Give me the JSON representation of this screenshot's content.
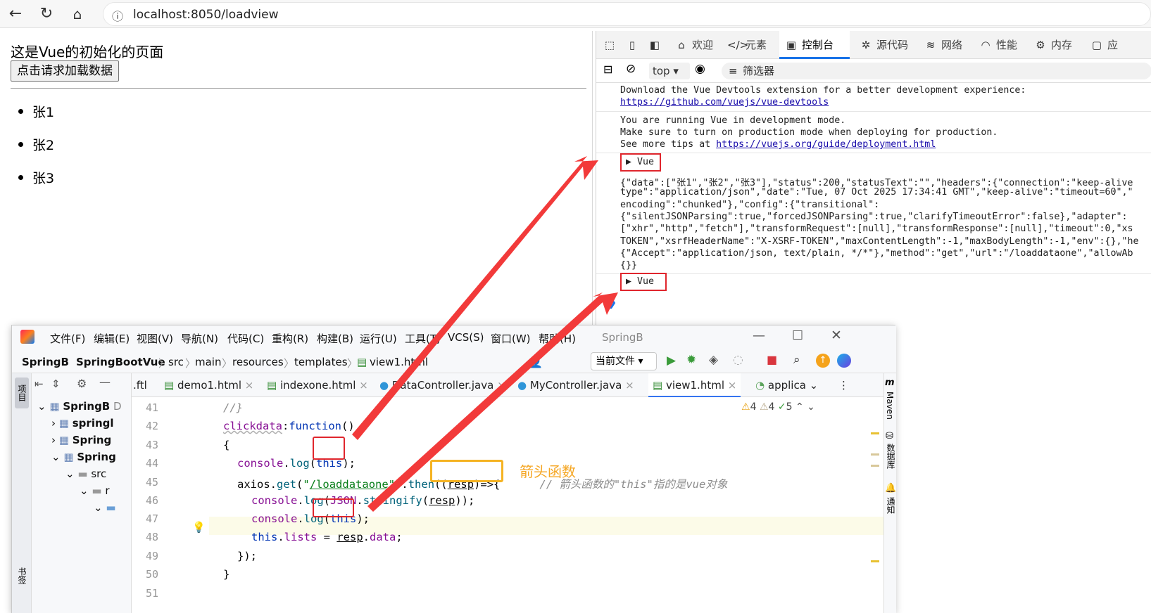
{
  "browser": {
    "url": "localhost:8050/loadview"
  },
  "page": {
    "title": "这是Vue的初始化的页面",
    "load_button": "点击请求加载数据",
    "items": [
      "张1",
      "张2",
      "张3"
    ]
  },
  "devtools": {
    "tabs": [
      "欢迎",
      "元素",
      "控制台",
      "源代码",
      "网络",
      "性能",
      "内存",
      "应"
    ],
    "context": "top",
    "filter": "筛选器",
    "console": {
      "devtools_msg": "Download the Vue Devtools extension for a better development experience:",
      "devtools_link": "https://github.com/vuejs/vue-devtools",
      "dev_mode_1": "You are running Vue in development mode.",
      "dev_mode_2": "Make sure to turn on production mode when deploying for production.",
      "dev_mode_3": "See more tips at",
      "dev_mode_link": "https://vuejs.org/guide/deployment.html",
      "vue_label": "Vue",
      "json_lines": [
        "{\"data\":[\"张1\",\"张2\",\"张3\"],\"status\":200,\"statusText\":\"\",\"headers\":{\"connection\":\"keep-alive",
        "type\":\"application/json\",\"date\":\"Tue, 07 Oct 2025 17:34:41 GMT\",\"keep-alive\":\"timeout=60\",\"",
        "encoding\":\"chunked\"},\"config\":{\"transitional\":",
        "{\"silentJSONParsing\":true,\"forcedJSONParsing\":true,\"clarifyTimeoutError\":false},\"adapter\":",
        "[\"xhr\",\"http\",\"fetch\"],\"transformRequest\":[null],\"transformResponse\":[null],\"timeout\":0,\"xs",
        "TOKEN\",\"xsrfHeaderName\":\"X-XSRF-TOKEN\",\"maxContentLength\":-1,\"maxBodyLength\":-1,\"env\":{},\"he",
        "{\"Accept\":\"application/json, text/plain, */*\"},\"method\":\"get\",\"url\":\"/loaddataone\",\"allowAb",
        "{}}"
      ]
    }
  },
  "ide": {
    "menu": [
      "文件(F)",
      "编辑(E)",
      "视图(V)",
      "导航(N)",
      "代码(C)",
      "重构(R)",
      "构建(B)",
      "运行(U)",
      "工具(T)",
      "VCS(S)",
      "窗口(W)",
      "帮助(H)",
      "SpringB"
    ],
    "breadcrumb": [
      "SpringB",
      "SpringBootVue",
      "src",
      "main",
      "resources",
      "templates",
      "view1.html"
    ],
    "run_config": "当前文件",
    "tabs": [
      ".ftl",
      "demo1.html",
      "indexone.html",
      "DataController.java",
      "MyController.java",
      "view1.html",
      "applica"
    ],
    "tree": [
      "SpringB",
      "springl",
      "Spring",
      "Spring",
      "src",
      "r",
      ""
    ],
    "tree_suffix": "D",
    "left_strip": [
      "项目",
      "书签"
    ],
    "right_strip": [
      "Maven",
      "数据库",
      "通知"
    ],
    "line_numbers": [
      "41",
      "42",
      "43",
      "44",
      "45",
      "46",
      "47",
      "48",
      "49",
      "50",
      "51"
    ],
    "inspections": {
      "warn1": "4",
      "warn2": "4",
      "ok": "5"
    },
    "comment": "// 箭头函数的\"this\"指的是vue对象"
  },
  "annotation": {
    "label": "箭头函数"
  },
  "colors": {
    "red": "#e0262d",
    "orange": "#f5b323",
    "accent": "#1a73e8"
  }
}
